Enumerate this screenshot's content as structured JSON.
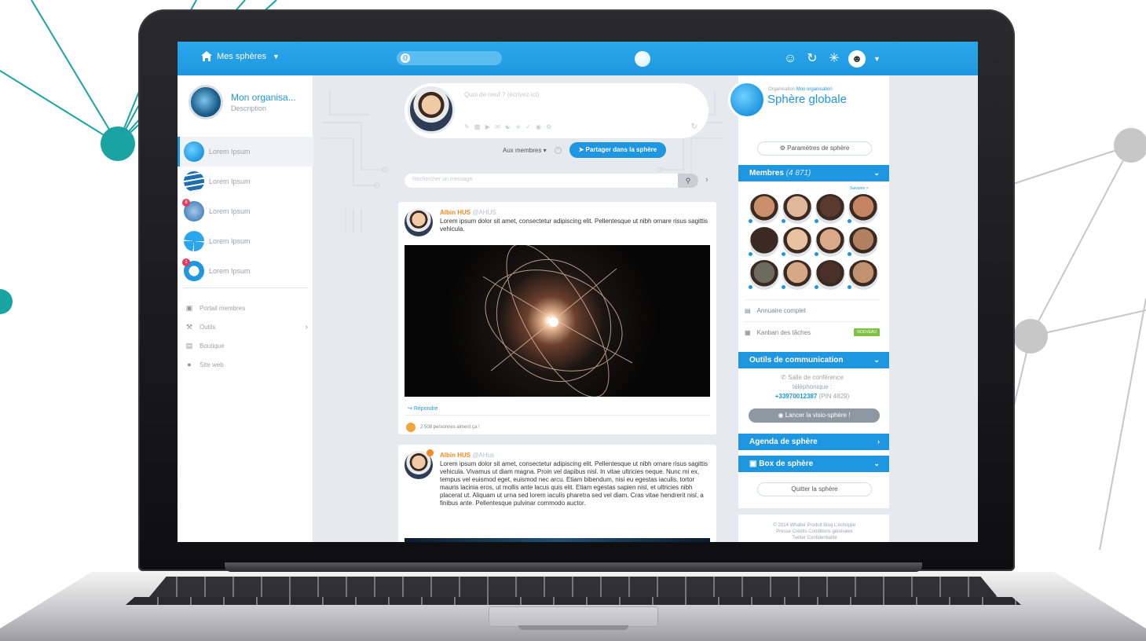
{
  "topbar": {
    "home_label": "Mes sphères",
    "search_symbol": "@"
  },
  "leftnav": {
    "org_name": "Mon organisa...",
    "org_description": "Description",
    "spheres": [
      {
        "label": "Lorem Ipsum",
        "color": "#1f97e0"
      },
      {
        "label": "Lorem Ipsum",
        "color": "#1f6fb0"
      },
      {
        "label": "Lorem Ipsum",
        "color": "#2b6cb0",
        "badge": "8"
      },
      {
        "label": "Lorem Ipsum",
        "color": "#2aa7ec"
      },
      {
        "label": "Lorem Ipsum",
        "color": "#1f97e0",
        "badge": "1"
      }
    ],
    "links": [
      {
        "label": "Portail membres",
        "icon": "portal-icon"
      },
      {
        "label": "Outils",
        "icon": "wrench-icon"
      },
      {
        "label": "Boutique",
        "icon": "store-icon"
      },
      {
        "label": "Site web",
        "icon": "globe-icon"
      }
    ]
  },
  "composer": {
    "placeholder": "Quoi de neuf ? (écrivez ici)",
    "audience": "Aux membres ▾",
    "share_label": "Partager dans la sphère"
  },
  "message_search": {
    "placeholder": "Rechercher un message"
  },
  "posts": [
    {
      "author": "Albin HUS",
      "handle": "@AHUS",
      "text": "Lorem ipsum dolor sit amet, consectetur adipiscing elit. Pellentesque ut nibh ornare risus sagittis vehicula.",
      "reply_label": "Répondre",
      "likes": "2 508 personnes aiment ça !"
    },
    {
      "author": "Albin HUS",
      "handle": "@AHus",
      "text": "Lorem ipsum dolor sit amet, consectetur adipiscing elit. Pellentesque ut nibh ornare risus sagittis vehicula. Vivamus ut diam magna. Proin vel dapibus nisl. In vitae ultricies neque. Nunc mi ex, tempus vel euismod eget, euismod nec arcu. Etiam bibendum, nisi eu egestas iaculis, tortor mauris lacinia eros, ut mollis ante lacus quis elit. Etiam egestas sapien nisl, et ultricies nibh placerat ut. Aliquam ut urna sed lorem iaculis pharetra sed vel diam. Cras vitae hendrerit nisl, a finibus ante. Pellentesque pulvinar commodo auctor."
    }
  ],
  "sphere_panel": {
    "org_prefix": "Organisation",
    "org_name": "Mon organisation",
    "title": "Sphère globale",
    "settings_label": "Paramètres de sphère",
    "members_title": "Membres",
    "members_count": "(4 871)",
    "follow_label": "Suivants >",
    "member_colors": [
      "#c98f6a",
      "#e0b79a",
      "#5a3a2e",
      "#c48463",
      "#3a2a22",
      "#e8c2a0",
      "#d9a98a",
      "#b08060",
      "#6b6b5e",
      "#d7a888",
      "#4a3028",
      "#c29270"
    ],
    "directory_label": "Annuaire complet",
    "kanban_label": "Kanban des tâches",
    "new_badge": "NOUVEAU",
    "comm_title": "Outils de communication",
    "conf_line1": "Salle de conférence",
    "conf_line2": "téléphonique :",
    "conf_phone": "+33970012387",
    "conf_pin": "(PIN 4829)",
    "visio_label": "Lancer la visio-sphère !",
    "agenda_title": "Agenda de sphère",
    "box_title": "Box de sphère",
    "quit_label": "Quitter la sphère",
    "footer_line1": "© 2014 Whaller   Produit   Blog   L'échoppe",
    "footer_line2": "Presse   Crédits   Conditions générales",
    "footer_line3": "Twitter   Confidentialité"
  }
}
